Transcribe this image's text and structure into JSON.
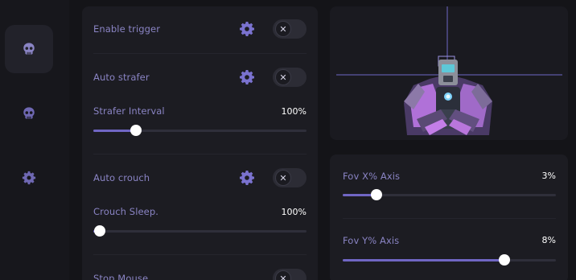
{
  "sidebar": {
    "items": [
      {
        "icon": "skull-icon",
        "active": true
      },
      {
        "icon": "skull-icon",
        "active": false
      },
      {
        "icon": "gear-icon",
        "active": false
      }
    ]
  },
  "left_panel": {
    "enable_trigger": {
      "label": "Enable trigger",
      "toggle_icon": "✕"
    },
    "auto_strafer": {
      "label": "Auto strafer",
      "toggle_icon": "✕"
    },
    "strafer_interval": {
      "label": "Strafer Interval",
      "value": "100%",
      "level": 0.2
    },
    "auto_crouch": {
      "label": "Auto crouch",
      "toggle_icon": "✕"
    },
    "crouch_sleep": {
      "label": "Crouch Sleep.",
      "value": "100%",
      "level": 0.03
    },
    "stop_mouse": {
      "label": "Stop Mouse",
      "toggle_icon": "✕"
    }
  },
  "right_panel": {
    "fov_x": {
      "label": "Fov X% Axis",
      "value": "3%",
      "level": 0.16
    },
    "fov_y": {
      "label": "Fov Y% Axis",
      "value": "8%",
      "level": 0.76
    }
  },
  "colors": {
    "accent": "#7066c4",
    "label": "#8a84c4",
    "background": "#141418",
    "panel": "#1c1c22"
  }
}
